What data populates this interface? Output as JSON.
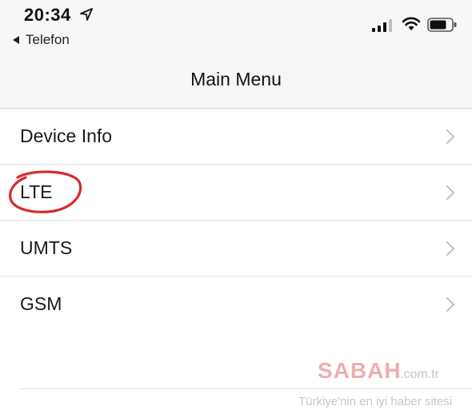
{
  "status_bar": {
    "time": "20:34",
    "back_app_label": "Telefon",
    "icons": [
      "location-arrow-icon",
      "back-triangle-icon",
      "signal-bars-icon",
      "wifi-icon",
      "battery-icon"
    ]
  },
  "nav": {
    "title": "Main Menu"
  },
  "menu": {
    "items": [
      {
        "label": "Device Info",
        "icon": "chevron-right-icon"
      },
      {
        "label": "LTE",
        "icon": "chevron-right-icon",
        "annotated": true
      },
      {
        "label": "UMTS",
        "icon": "chevron-right-icon"
      },
      {
        "label": "GSM",
        "icon": "chevron-right-icon"
      }
    ]
  },
  "annotation": {
    "shape": "red circle",
    "color": "#d62a2a",
    "target": "LTE"
  },
  "watermark": {
    "logo": "SABAH",
    "domain": ".com.tr",
    "tagline": "Türkiye'nin en iyi haber sitesi",
    "color": "#d22828"
  },
  "colors": {
    "bar_background": "#f7f7f7",
    "separator": "#dcdcde",
    "chevron": "#c4c4c7",
    "text": "#1a1a1a"
  }
}
